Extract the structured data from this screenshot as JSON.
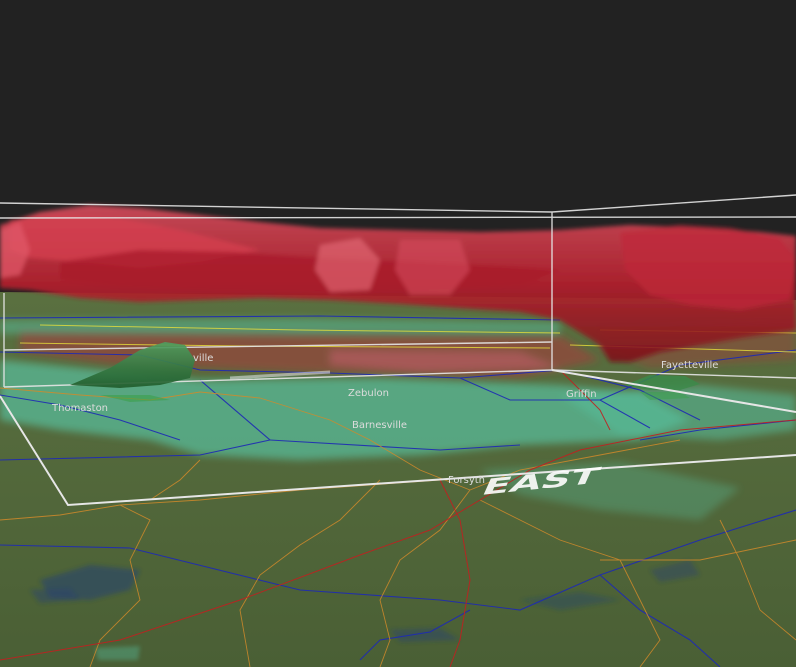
{
  "scene": {
    "sky_color": "#222222",
    "ground_color": "#4d6437",
    "reflectivity_colors": {
      "low": "#58c8a8",
      "mid": "#3c8a4a",
      "high": "#c4283a"
    },
    "county_line_color": "#1e2ab4",
    "road_color": "#d28a2a",
    "highway_color": "#c02020",
    "box_color": "#e6e6e6"
  },
  "places": {
    "thomaston": "Thomaston",
    "zebulon": "Zebulon",
    "barnesville": "Barnesville",
    "griffin": "Griffin",
    "fayetteville": "Fayetteville",
    "forsyth": "Forsyth",
    "partial_ville": "ville"
  },
  "axis_labels": {
    "east": "EAST"
  }
}
